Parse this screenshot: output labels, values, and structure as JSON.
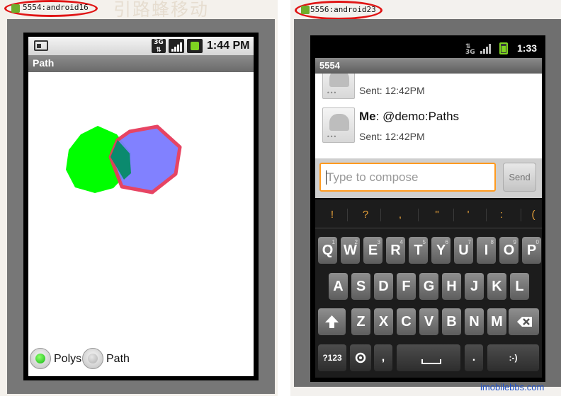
{
  "left_emulator": {
    "title": "5554:android16",
    "banner_text": "引路蜂移动",
    "status_bar": {
      "network": "3G",
      "time": "1:44 PM"
    },
    "app_title": "Path",
    "canvas": {
      "fill_polygon_color": "#00ff00",
      "stroke_polygon_color": "#e63b5b",
      "overlay_polygon_color": "#7b7bff",
      "overlap_color": "#0b8a6e"
    },
    "radio_group": {
      "options": [
        {
          "label": "Polys",
          "selected": true
        },
        {
          "label": "Path",
          "selected": false
        }
      ]
    }
  },
  "right_emulator": {
    "title": "5556:android23",
    "faded_header": "",
    "status_bar": {
      "network": "3G",
      "time": "1:33"
    },
    "thread_title": "5554",
    "messages": [
      {
        "sender": "",
        "body": "",
        "sent": "Sent: 12:42PM"
      },
      {
        "sender": "Me",
        "body": ": @demo:Paths",
        "sent": "Sent: 12:42PM"
      }
    ],
    "compose": {
      "placeholder": "Type to compose",
      "send_label": "Send"
    },
    "suggestions": [
      "!",
      "?",
      ",",
      "\"",
      "'",
      ":",
      "("
    ],
    "keyboard": {
      "row1": [
        {
          "k": "Q",
          "alt": "1"
        },
        {
          "k": "W",
          "alt": "2"
        },
        {
          "k": "E",
          "alt": "3"
        },
        {
          "k": "R",
          "alt": "4"
        },
        {
          "k": "T",
          "alt": "5"
        },
        {
          "k": "Y",
          "alt": "6"
        },
        {
          "k": "U",
          "alt": "7"
        },
        {
          "k": "I",
          "alt": "8"
        },
        {
          "k": "O",
          "alt": "9"
        },
        {
          "k": "P",
          "alt": "0"
        }
      ],
      "row2": [
        "A",
        "S",
        "D",
        "F",
        "G",
        "H",
        "J",
        "K",
        "L"
      ],
      "row3": [
        "Z",
        "X",
        "C",
        "V",
        "B",
        "N",
        "M"
      ],
      "mode_key": "?123",
      "period_key": ".",
      "comma_key": ",",
      "smiley_key": ":-)"
    }
  },
  "watermark": "imobilebbs.com"
}
